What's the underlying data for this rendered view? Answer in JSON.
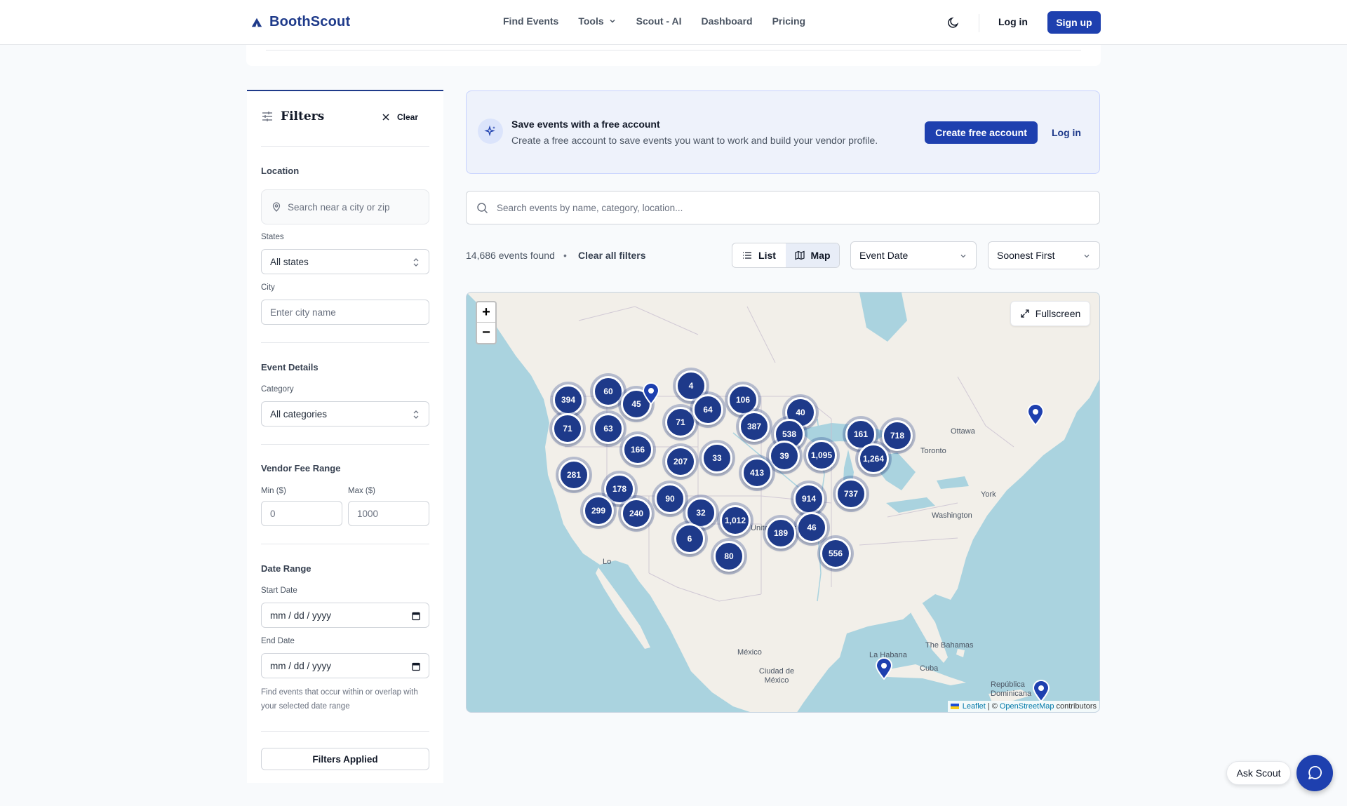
{
  "header": {
    "brand": "BoothScout",
    "nav": [
      "Find Events",
      "Tools",
      "Scout - AI",
      "Dashboard",
      "Pricing"
    ],
    "login": "Log in",
    "signup": "Sign up"
  },
  "sidebar": {
    "title": "Filters",
    "clear": "Clear",
    "location_section": "Location",
    "location_placeholder": "Search near a city or zip",
    "states_label": "States",
    "states_value": "All states",
    "city_label": "City",
    "city_placeholder": "Enter city name",
    "event_details_section": "Event Details",
    "category_label": "Category",
    "category_value": "All categories",
    "fee_section": "Vendor Fee Range",
    "fee_min_label": "Min ($)",
    "fee_max_label": "Max ($)",
    "fee_min_value": "0",
    "fee_max_value": "1000",
    "date_section": "Date Range",
    "start_label": "Start Date",
    "start_value": "mm / dd / yyyy",
    "end_label": "End Date",
    "end_value": "mm / dd / yyyy",
    "date_note": "Find events that occur within or overlap with your selected date range",
    "applied": "Filters Applied"
  },
  "banner": {
    "title": "Save events with a free account",
    "text": "Create a free account to save events you want to work and build your vendor profile.",
    "create": "Create free account",
    "login": "Log in"
  },
  "search": {
    "placeholder": "Search events by name, category, location..."
  },
  "toolbar": {
    "count": "14,686 events found",
    "separator": "•",
    "clear_all": "Clear all filters",
    "list": "List",
    "map": "Map",
    "active_view": "Map",
    "sort_field": "Event Date",
    "sort_order": "Soonest First"
  },
  "map": {
    "zoom_in": "+",
    "zoom_out": "−",
    "fullscreen": "Fullscreen",
    "attribution_leaflet": "Leaflet",
    "attribution_sep": "| ©",
    "attribution_osm": "OpenStreetMap",
    "attribution_tail": "contributors",
    "place_labels": [
      "Ottawa",
      "Toronto",
      "York",
      "Washington",
      "United States",
      "Lo",
      "México",
      "Ciudad de México",
      "La Habana",
      "Cuba",
      "The Bahamas",
      "República Dominicana"
    ],
    "clusters": [
      "394",
      "60",
      "45",
      "4",
      "106",
      "71",
      "63",
      "71",
      "64",
      "387",
      "40",
      "538",
      "161",
      "718",
      "166",
      "207",
      "33",
      "39",
      "1,095",
      "1,264",
      "281",
      "413",
      "178",
      "90",
      "914",
      "737",
      "299",
      "240",
      "32",
      "1,012",
      "46",
      "189",
      "6",
      "80",
      "556"
    ]
  },
  "floating": {
    "ask_scout": "Ask Scout"
  },
  "colors": {
    "primary": "#1e40af",
    "brand": "#1e3a8a",
    "water": "#aad3df",
    "land": "#f2efe9"
  }
}
